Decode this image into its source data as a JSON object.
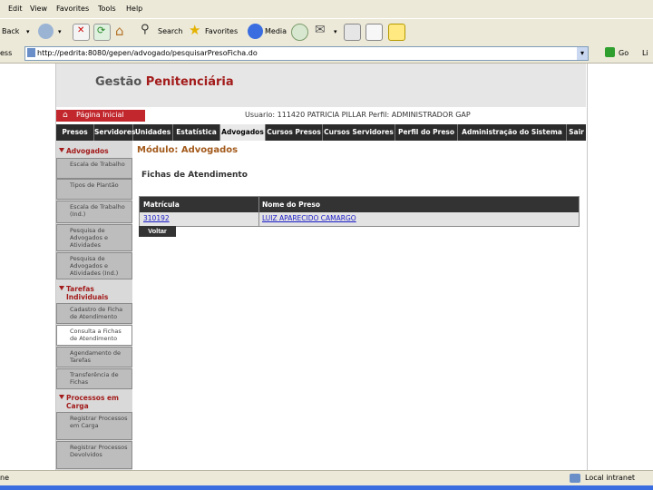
{
  "browser": {
    "menu": [
      "Edit",
      "View",
      "Favorites",
      "Tools",
      "Help"
    ],
    "toolbar": {
      "back": "Back",
      "search": "Search",
      "favorites": "Favorites",
      "media": "Media"
    },
    "address_label": "ess",
    "address_url": "http://pedrita:8080/gepen/advogado/pesquisarPresoFicha.do",
    "go_label": "Go",
    "links_label": "Li",
    "status_left": "ne",
    "status_zone": "Local intranet"
  },
  "page": {
    "brand_part1": "Gestão",
    "brand_part2": "Penitenciária",
    "home_tab": "Página Inicial",
    "user_line": "Usuario: 111420   PATRICIA PILLAR   Perfil: ADMINISTRADOR   GAP",
    "nav": [
      {
        "label": "Presos"
      },
      {
        "label": "Servidores"
      },
      {
        "label": "Unidades"
      },
      {
        "label": "Estatística"
      },
      {
        "label": "Advogados",
        "active": true
      },
      {
        "label": "Cursos Presos"
      },
      {
        "label": "Cursos Servidores"
      },
      {
        "label": "Perfil do Preso"
      },
      {
        "label": "Administração do Sistema"
      },
      {
        "label": "Sair"
      }
    ],
    "sidebar": {
      "sections": [
        {
          "title": "Advogados"
        },
        {
          "title": "Tarefas Individuais"
        },
        {
          "title": "Processos em Carga"
        }
      ],
      "items": [
        {
          "label": "Escala de Trabalho"
        },
        {
          "label": "Tipos de Plantão"
        },
        {
          "label": "Escala de Trabalho (Ind.)"
        },
        {
          "label": "Pesquisa de Advogados e Atividades"
        },
        {
          "label": "Pesquisa de Advogados e Atividades (Ind.)"
        },
        {
          "label": "Cadastro de Ficha de Atendimento"
        },
        {
          "label": "Consulta a Fichas de Atendimento",
          "active": true
        },
        {
          "label": "Agendamento de Tarefas"
        },
        {
          "label": "Transferência de Fichas"
        },
        {
          "label": "Registrar Processos em Carga"
        },
        {
          "label": "Registrar Processos Devolvidos"
        }
      ]
    },
    "module_title": "Módulo: Advogados",
    "section_title": "Fichas de Atendimento",
    "table": {
      "headers": [
        "Matrícula",
        "Nome do Preso"
      ],
      "rows": [
        [
          "310192",
          "LUIZ APARECIDO CAMARGO"
        ]
      ]
    },
    "voltar_label": "Voltar"
  }
}
